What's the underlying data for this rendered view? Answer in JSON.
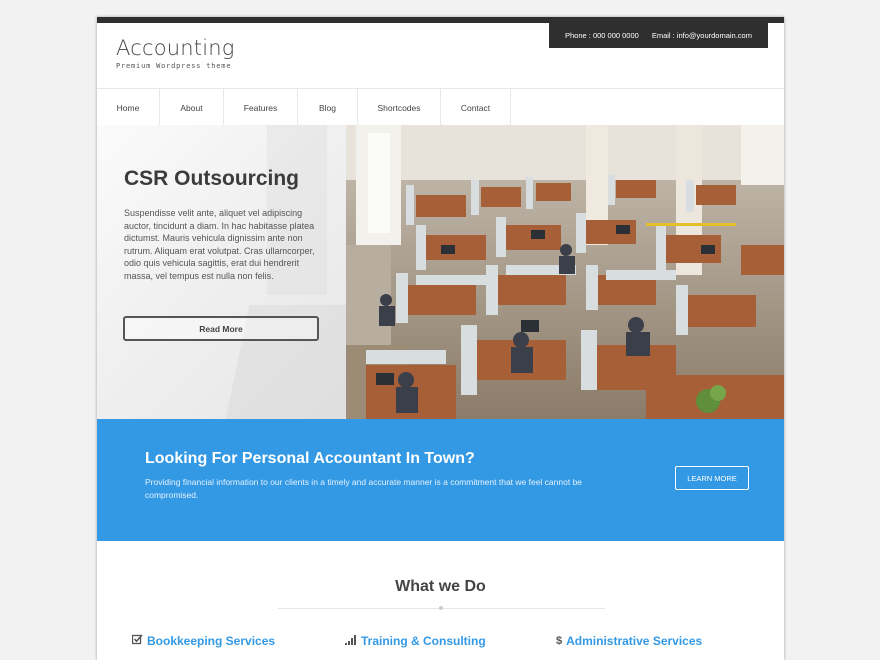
{
  "header": {
    "phone": "Phone : 000 000 0000",
    "email": "Email : info@yourdomain.com",
    "logo_title": "Accounting",
    "logo_subtitle": "Premium Wordpress theme"
  },
  "nav": {
    "items": [
      "Home",
      "About",
      "Features",
      "Blog",
      "Shortcodes",
      "Contact"
    ]
  },
  "hero": {
    "title": "CSR Outsourcing",
    "text": "Suspendisse velit ante, aliquet vel adipiscing auctor, tincidunt a diam. In hac habitasse platea dictumst. Mauris vehicula dignissim ante non rutrum. Aliquam erat volutpat. Cras ullamcorper, odio quis vehicula sagittis, erat dui hendrerit massa, vel tempus est nulla non felis.",
    "button": "Read More",
    "image": "office-cubicles-photo"
  },
  "banner": {
    "title": "Looking For Personal Accountant In Town?",
    "text": "Providing financial information to our clients in a timely and accurate manner is a commitment that we feel cannot be compromised.",
    "button": "LEARN MORE",
    "color": "#3399e5"
  },
  "services": {
    "title": "What we Do",
    "items": [
      {
        "label": "Bookkeeping Services",
        "icon": "checkbox-icon"
      },
      {
        "label": "Training & Consulting",
        "icon": "signal-bars-icon"
      },
      {
        "label": "Administrative Services",
        "icon": "dollar-icon"
      }
    ]
  }
}
